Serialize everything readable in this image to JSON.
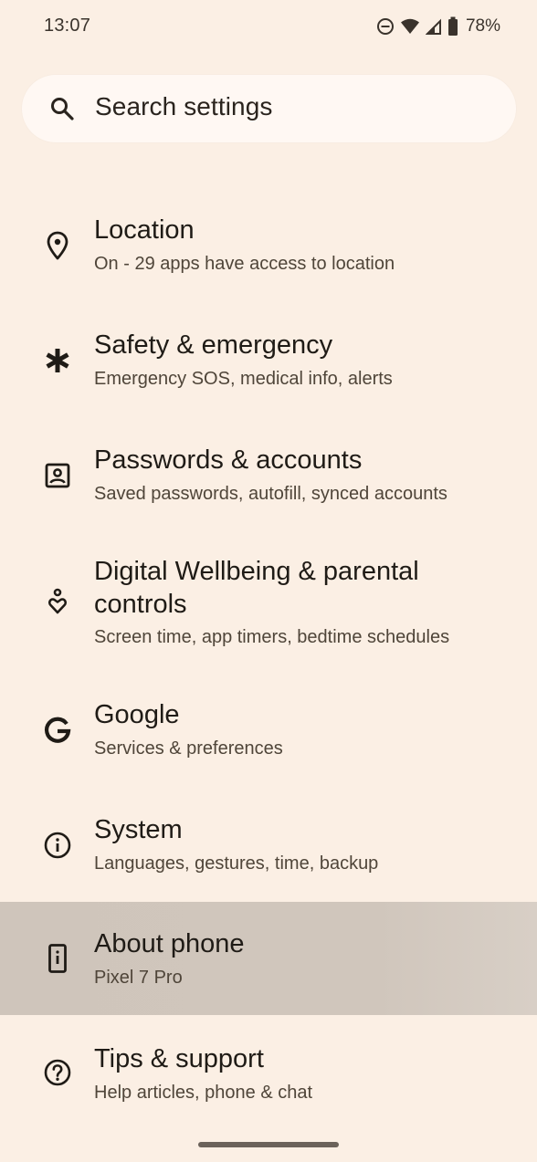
{
  "status": {
    "time": "13:07",
    "battery": "78%"
  },
  "search": {
    "placeholder": "Search settings"
  },
  "items": [
    {
      "title": "Location",
      "subtitle": "On - 29 apps have access to location",
      "icon": "location-pin-icon"
    },
    {
      "title": "Safety & emergency",
      "subtitle": "Emergency SOS, medical info, alerts",
      "icon": "asterisk-icon"
    },
    {
      "title": "Passwords & accounts",
      "subtitle": "Saved passwords, autofill, synced accounts",
      "icon": "account-box-icon"
    },
    {
      "title": "Digital Wellbeing & parental controls",
      "subtitle": "Screen time, app timers, bedtime schedules",
      "icon": "wellbeing-icon"
    },
    {
      "title": "Google",
      "subtitle": "Services & preferences",
      "icon": "google-g-icon"
    },
    {
      "title": "System",
      "subtitle": "Languages, gestures, time, backup",
      "icon": "info-icon"
    },
    {
      "title": "About phone",
      "subtitle": "Pixel 7 Pro",
      "icon": "phone-info-icon"
    },
    {
      "title": "Tips & support",
      "subtitle": "Help articles, phone & chat",
      "icon": "help-circle-icon"
    }
  ]
}
